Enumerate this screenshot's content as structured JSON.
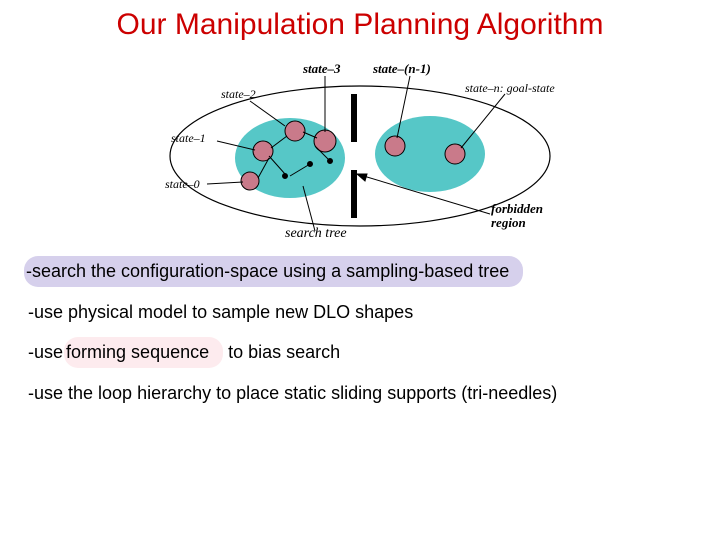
{
  "title": "Our Manipulation Planning Algorithm",
  "diagram": {
    "state_labels": {
      "s0": "state–0",
      "s1": "state–1",
      "s2": "state–2",
      "s3": "state–3",
      "sn1": "state–(n-1)",
      "sn": "state–n: goal-state"
    },
    "search_tree": "search tree",
    "forbidden": "forbidden\nregion"
  },
  "bullets": {
    "b1": "-search the configuration-space using a sampling-based tree",
    "b2": "-use physical model to sample new DLO shapes",
    "b3_a": "-use ",
    "b3_b": "forming sequence",
    "b3_c": " to bias search",
    "b4": "-use the loop hierarchy to place static sliding supports (tri-needles)"
  }
}
